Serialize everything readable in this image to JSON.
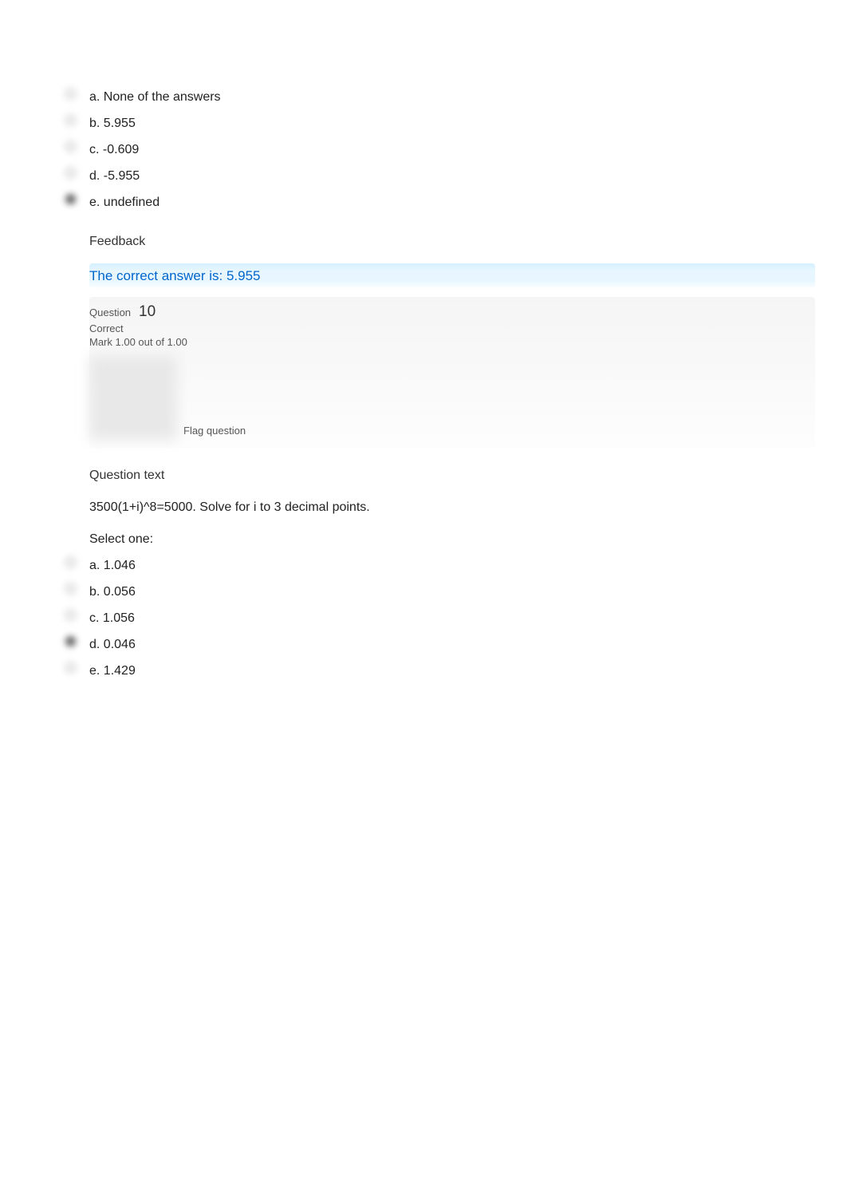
{
  "question9": {
    "options": [
      {
        "letter": "a.",
        "text": "None of the answers",
        "selected": false
      },
      {
        "letter": "b.",
        "text": "5.955",
        "selected": false
      },
      {
        "letter": "c.",
        "text": "-0.609",
        "selected": false
      },
      {
        "letter": "d.",
        "text": "-5.955",
        "selected": false
      },
      {
        "letter": "e.",
        "text": "undefined",
        "selected": true
      }
    ],
    "feedback_label": "Feedback",
    "feedback_answer": "The correct answer is: 5.955"
  },
  "question10": {
    "header": {
      "question_label": "Question",
      "number": "10",
      "correct": "Correct",
      "mark": "Mark 1.00 out of 1.00",
      "flag_label": "Flag question"
    },
    "question_text_heading": "Question text",
    "question_body": "3500(1+i)^8=5000. Solve for i to 3 decimal points.",
    "select_one": "Select one:",
    "options": [
      {
        "letter": "a.",
        "text": "1.046",
        "selected": false
      },
      {
        "letter": "b.",
        "text": "0.056",
        "selected": false
      },
      {
        "letter": "c.",
        "text": "1.056",
        "selected": false
      },
      {
        "letter": "d.",
        "text": "0.046",
        "selected": true
      },
      {
        "letter": "e.",
        "text": "1.429",
        "selected": false
      }
    ]
  }
}
